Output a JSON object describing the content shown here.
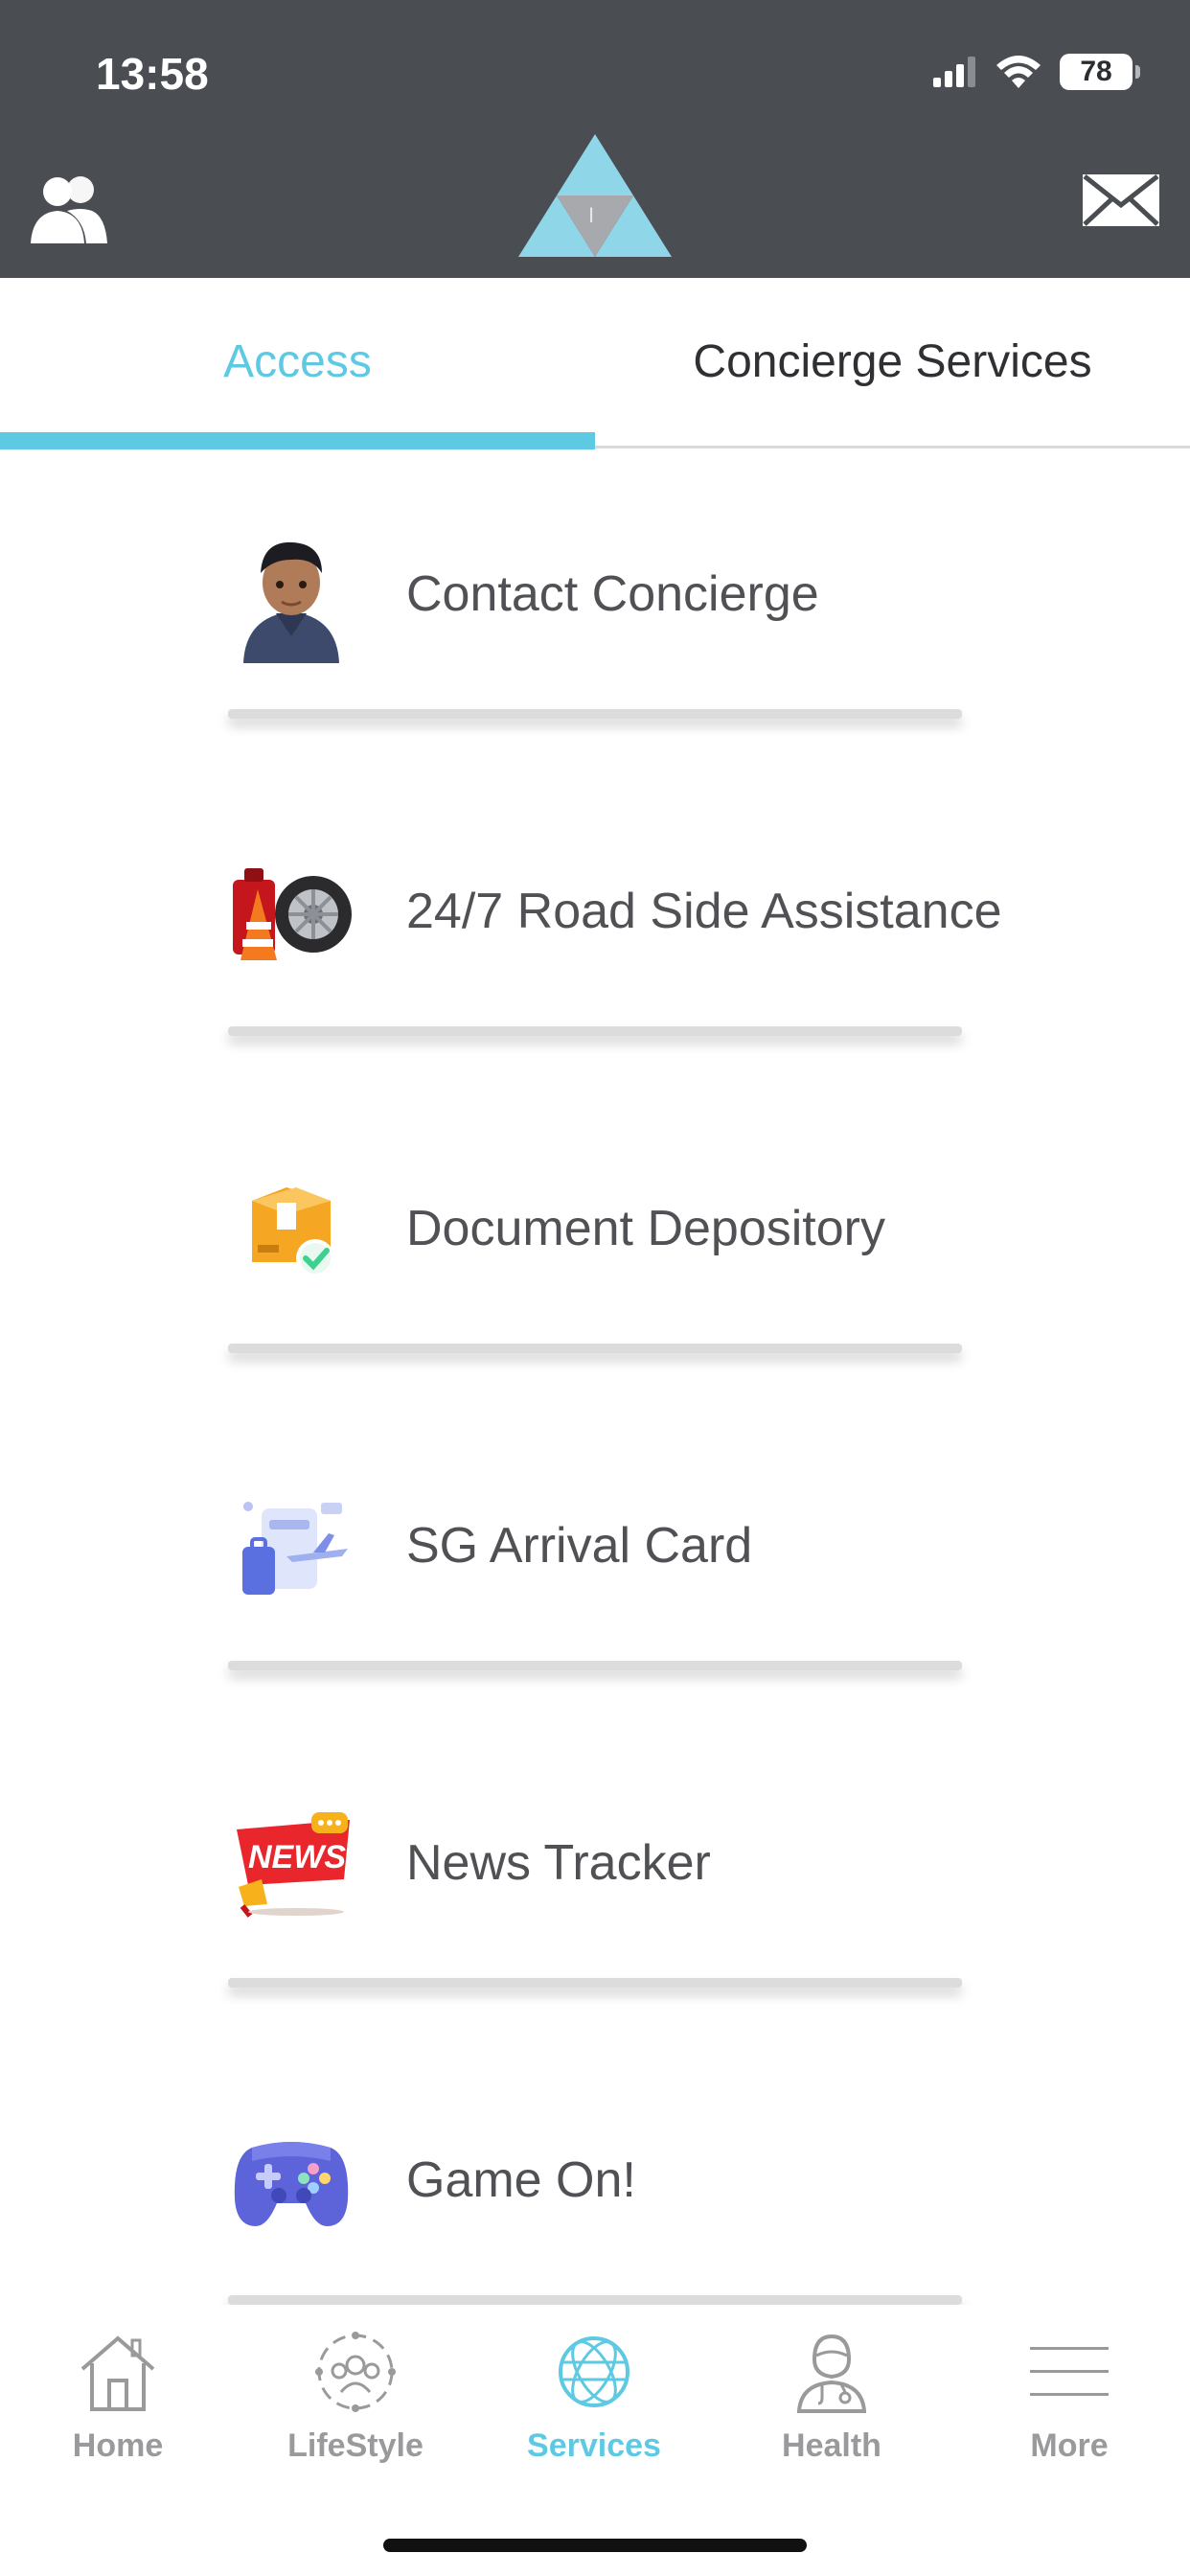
{
  "status_bar": {
    "time": "13:58",
    "battery": "78"
  },
  "header": {
    "left_icon": "contacts-icon",
    "logo": "triangle-logo",
    "right_icon": "mail-icon",
    "logo_letter": "I"
  },
  "tabs": [
    {
      "label": "Access",
      "active": true
    },
    {
      "label": "Concierge Services",
      "active": false
    }
  ],
  "services": [
    {
      "label": "Contact Concierge",
      "icon": "concierge-avatar-icon"
    },
    {
      "label": "24/7 Road Side Assistance",
      "icon": "roadside-tyre-icon"
    },
    {
      "label": "Document Depository",
      "icon": "document-box-icon"
    },
    {
      "label": "SG Arrival Card",
      "icon": "travel-luggage-icon"
    },
    {
      "label": "News Tracker",
      "icon": "news-megaphone-icon",
      "icon_text": "NEWS"
    },
    {
      "label": "Game On!",
      "icon": "gamepad-icon"
    }
  ],
  "bottom_nav": [
    {
      "label": "Home",
      "icon": "home-icon",
      "active": false
    },
    {
      "label": "LifeStyle",
      "icon": "lifestyle-icon",
      "active": false
    },
    {
      "label": "Services",
      "icon": "globe-icon",
      "active": true
    },
    {
      "label": "Health",
      "icon": "doctor-icon",
      "active": false
    },
    {
      "label": "More",
      "icon": "menu-icon",
      "active": false
    }
  ],
  "colors": {
    "header_bg": "#4a4d52",
    "accent": "#5ec9e2",
    "text": "#505155",
    "nav_inactive": "#9a9a9d"
  }
}
